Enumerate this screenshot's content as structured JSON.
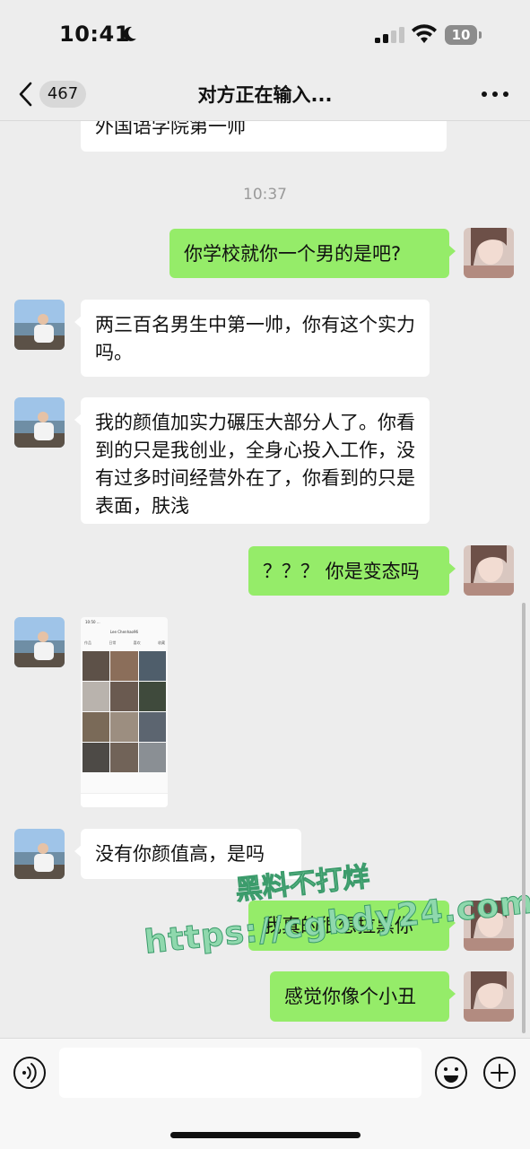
{
  "status_bar": {
    "time": "10:41",
    "battery": "10"
  },
  "nav": {
    "unread_count": "467",
    "title": "对方正在输入..."
  },
  "messages": [
    {
      "side": "left",
      "text": "外国语学院第一帅"
    },
    {
      "side": "right",
      "text": "你学校就你一个男的是吧?"
    },
    {
      "side": "left",
      "text": "两三百名男生中第一帅，你有这个实力吗。"
    },
    {
      "side": "left",
      "text": "我的颜值加实力碾压大部分人了。你看到的只是我创业，全身心投入工作，没有过多时间经营外在了，你看到的只是表面，肤浅"
    },
    {
      "side": "right",
      "text": "？？？ 你是变态吗"
    },
    {
      "side": "left",
      "type": "image",
      "image": "screenshot-of-profile-video-grid"
    },
    {
      "side": "left",
      "text": "没有你颜值高，是吗"
    },
    {
      "side": "right",
      "text": "我真的很想拉黑你"
    },
    {
      "side": "right",
      "text": "感觉你像个小丑"
    }
  ],
  "timestamp": "10:37",
  "image_message": {
    "mini_time": "10:50 ...",
    "mini_name": "Lee Chenhao96",
    "mini_tabs": [
      "作品",
      "日常",
      "喜欢",
      "收藏"
    ]
  },
  "watermark": {
    "line1": "黑料不打烊",
    "line2": "https://cgbdy24.com"
  },
  "icons": [
    "back-chevron-icon",
    "moon-icon",
    "signal-icon",
    "wifi-icon",
    "battery-icon",
    "more-dots-icon",
    "voice-icon",
    "emoji-icon",
    "plus-icon"
  ],
  "colors": {
    "background": "#ededed",
    "bubble_green": "#95ec69",
    "bubble_white": "#ffffff"
  }
}
